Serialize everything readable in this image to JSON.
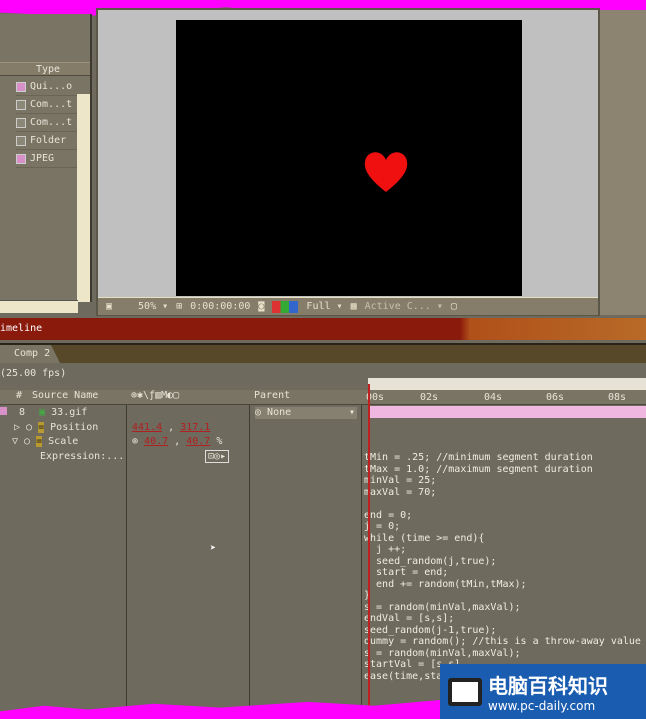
{
  "project": {
    "type_header": "Type",
    "items": [
      {
        "label": "Qui...o",
        "color": "#d890c8"
      },
      {
        "label": "Com...t",
        "color": "#8c8878"
      },
      {
        "label": "Com...t",
        "color": "#8c8878"
      },
      {
        "label": "Folder",
        "color": "#8c8878"
      },
      {
        "label": "JPEG",
        "color": "#d890c8"
      }
    ]
  },
  "viewer": {
    "zoom": "50%",
    "timecode": "0:00:00:00",
    "resolution": "Full",
    "camera": "Active C..."
  },
  "timeline": {
    "title": "imeline",
    "tab": "Comp 2",
    "fps": "(25.00 fps)",
    "headers": {
      "num": "#",
      "source": "Source Name",
      "switches": "⊕✱\\ƒ▥M◐▢",
      "parent": "Parent"
    },
    "ticks": [
      "00s",
      "02s",
      "04s",
      "06s",
      "08s"
    ],
    "layer": {
      "num": "8",
      "name": "33.gif",
      "parent": "None"
    },
    "position": {
      "label": "Position",
      "x": "441.4",
      "y": "317.1"
    },
    "scale": {
      "label": "Scale",
      "x": "40.7",
      "y": "40.7",
      "unit": "%"
    },
    "expression_label": "Expression:..."
  },
  "code": "tMin = .25; //minimum segment duration\ntMax = 1.0; //maximum segment duration\nminVal = 25;\nmaxVal = 70;\n\nend = 0;\nj = 0;\nwhile (time >= end){\n  j ++;\n  seed_random(j,true);\n  start = end;\n  end += random(tMin,tMax);\n}\ns = random(minVal,maxVal);\nendVal = [s,s];\nseed_random(j-1,true);\ndummy = random(); //this is a throw-away value\ns = random(minVal,maxVal);\nstartVal = [s,s]\nease(time,sta",
  "watermark": {
    "title": "电脑百科知识",
    "url": "www.pc-daily.com"
  }
}
